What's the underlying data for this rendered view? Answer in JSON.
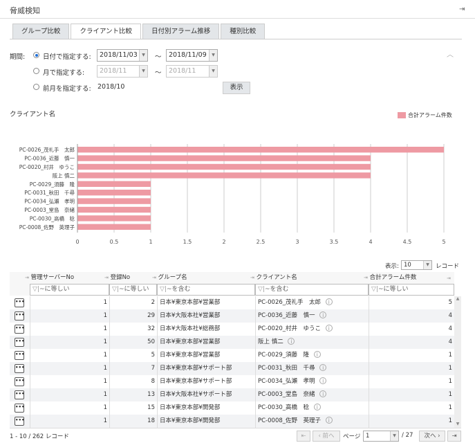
{
  "header": {
    "title": "脅威検知",
    "logout_icon": "logout-icon"
  },
  "tabs": [
    {
      "label": "グループ比較"
    },
    {
      "label": "クライアント比較",
      "active": true
    },
    {
      "label": "日付別アラーム推移"
    },
    {
      "label": "種別比較"
    }
  ],
  "period": {
    "label": "期間:",
    "by_date_label": "日付で指定する:",
    "date_from": "2018/11/03",
    "date_to": "2018/11/09",
    "by_month_label": "月で指定する:",
    "month_from": "2018/11",
    "month_to": "2018/11",
    "prev_month_label": "前月を指定する:",
    "prev_month_value": "2018/10",
    "tilde": "～",
    "show_button": "表示",
    "selected": "by_date"
  },
  "chart_data": {
    "type": "bar",
    "orientation": "horizontal",
    "title": "クライアント名",
    "legend": "合計アラーム件数",
    "legend_position": "top-right",
    "color": "#ee9aa3",
    "xlim": [
      0,
      5
    ],
    "xticks": [
      "0",
      "0.5",
      "1",
      "1.5",
      "2",
      "2.5",
      "3",
      "3.5",
      "4",
      "4.5",
      "5"
    ],
    "grid": true,
    "categories": [
      "PC-0026_茂礼手　太郎",
      "PC-0036_近藤　慎一",
      "PC-0020_村井　ゆうこ",
      "阪上 慎二",
      "PC-0029_須藤　隆",
      "PC-0031_秋田　千尋",
      "PC-0034_弘瀬　孝明",
      "PC-0003_堂島　奈緒",
      "PC-0030_高橋　稔",
      "PC-0008_佐野　英理子"
    ],
    "values": [
      5,
      4,
      4,
      4,
      1,
      1,
      1,
      1,
      1,
      1
    ]
  },
  "table": {
    "page_size_label": "表示:",
    "page_size": "10",
    "records_label": "レコード",
    "columns": [
      "管理サーバーNo",
      "登録No",
      "グループ名",
      "クライアント名",
      "合計アラーム件数"
    ],
    "filters": [
      "~に等しい",
      "~に等しい",
      "~を含む",
      "~を含む",
      "~に等しい"
    ],
    "rows": [
      [
        "1",
        "2",
        "日本¥東京本部¥営業部",
        "PC-0026_茂礼手　太郎",
        "5"
      ],
      [
        "1",
        "29",
        "日本¥大阪本社¥営業部",
        "PC-0036_近藤　慎一",
        "4"
      ],
      [
        "1",
        "32",
        "日本¥大阪本社¥総務部",
        "PC-0020_村井　ゆうこ",
        "4"
      ],
      [
        "1",
        "50",
        "日本¥東京本部¥営業部",
        "阪上 慎二",
        "4"
      ],
      [
        "1",
        "5",
        "日本¥東京本部¥営業部",
        "PC-0029_須藤　隆",
        "1"
      ],
      [
        "1",
        "7",
        "日本¥東京本部¥サポート部",
        "PC-0031_秋田　千尋",
        "1"
      ],
      [
        "1",
        "8",
        "日本¥東京本部¥サポート部",
        "PC-0034_弘瀬　孝明",
        "1"
      ],
      [
        "1",
        "13",
        "日本¥大阪本社¥サポート部",
        "PC-0003_堂島　奈緒",
        "1"
      ],
      [
        "1",
        "15",
        "日本¥東京本部¥開発部",
        "PC-0030_高橋　稔",
        "1"
      ],
      [
        "1",
        "18",
        "日本¥東京本部¥開発部",
        "PC-0008_佐野　英理子",
        "1"
      ]
    ]
  },
  "pager": {
    "summary": "1 - 10 / 262 レコード",
    "first": "⇤",
    "prev": "前へ",
    "page_label": "ページ",
    "page": "1",
    "total": "/ 27",
    "next": "次へ",
    "last": "⇥"
  }
}
